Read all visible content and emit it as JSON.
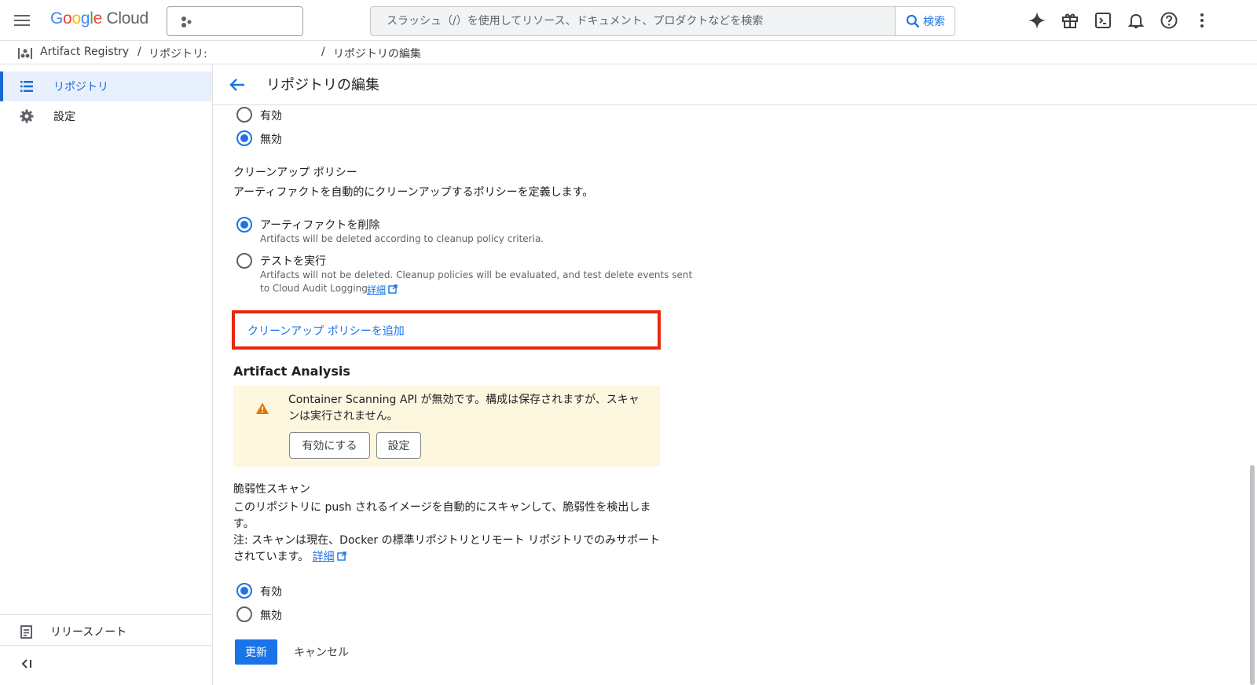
{
  "topbar": {
    "logo": {
      "G": "G",
      "o1": "o",
      "o2": "o",
      "g": "g",
      "l": "l",
      "e": "e",
      "cloud": " Cloud"
    },
    "search_placeholder": "スラッシュ（/）を使用してリソース、ドキュメント、プロダクトなどを検索",
    "search_button": "検索",
    "icons": [
      "gemini-icon",
      "gift-icon",
      "cloud-shell-icon",
      "notifications-icon",
      "help-icon",
      "more-vert-icon"
    ]
  },
  "breadcrumb": {
    "product": "Artifact Registry",
    "sep1": "/",
    "repo_label": "リポジトリ:",
    "sep2": "/",
    "current": "リポジトリの編集"
  },
  "sidebar": {
    "items": [
      {
        "label": "リポジトリ",
        "icon": "list-icon",
        "active": true
      },
      {
        "label": "設定",
        "icon": "gear-icon",
        "active": false
      }
    ],
    "release_notes": "リリースノート",
    "collapse_icon": "collapse-icon"
  },
  "main": {
    "title": "リポジトリの編集",
    "top_radio": {
      "enabled": "有効",
      "disabled": "無効",
      "selected": "disabled"
    },
    "cleanup": {
      "heading": "クリーンアップ ポリシー",
      "description": "アーティファクトを自動的にクリーンアップするポリシーを定義します。",
      "delete_label": "アーティファクトを削除",
      "delete_help": "Artifacts will be deleted according to cleanup policy criteria.",
      "dryrun_label": "テストを実行",
      "dryrun_help_1": "Artifacts will not be deleted. Cleanup policies will be evaluated, and test delete events sent",
      "dryrun_help_2": "to Cloud Audit Logging.",
      "learn_more": "詳細",
      "selected": "delete",
      "add_policy": "クリーンアップ ポリシーを追加"
    },
    "analysis": {
      "title": "Artifact Analysis",
      "warning": "Container Scanning API が無効です。構成は保存されますが、スキャンは実行されません。",
      "enable_btn": "有効にする",
      "settings_btn": "設定",
      "warning_color": "#fef7e0"
    },
    "vuln": {
      "heading": "脆弱性スキャン",
      "description": "このリポジトリに push されるイメージを自動的にスキャンして、脆弱性を検出します。",
      "note": "注: スキャンは現在、Docker の標準リポジトリとリモート リポジトリでのみサポートされています。",
      "learn_more": "詳細",
      "enabled": "有効",
      "disabled": "無効",
      "selected": "enabled"
    },
    "actions": {
      "update": "更新",
      "cancel": "キャンセル"
    }
  },
  "colors": {
    "accent": "#1a73e8",
    "highlight": "#e8290c"
  }
}
